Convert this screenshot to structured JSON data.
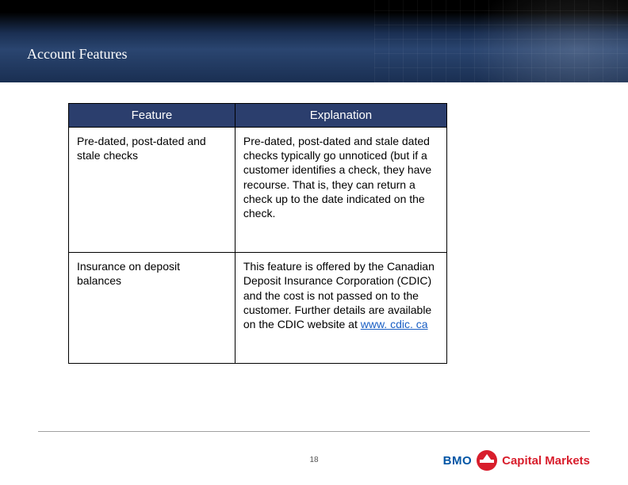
{
  "slide": {
    "title": "Account Features",
    "page_number": "18"
  },
  "table": {
    "headers": {
      "feature": "Feature",
      "explanation": "Explanation"
    },
    "rows": [
      {
        "feature": "Pre-dated, post-dated and stale checks",
        "explanation": "Pre-dated, post-dated and stale dated checks typically go unnoticed (but if a customer identifies a check, they have recourse. That is, they can return a check up to the date indicated on the check."
      },
      {
        "feature": "Insurance on deposit balances",
        "explanation_prefix": "This feature is offered by the Canadian Deposit Insurance Corporation (CDIC) and the cost is not passed on to the customer. Further details are available on the CDIC website at ",
        "link_text": "www. cdic. ca"
      }
    ]
  },
  "brand": {
    "bmo": "BMO",
    "cm": "Capital Markets"
  }
}
